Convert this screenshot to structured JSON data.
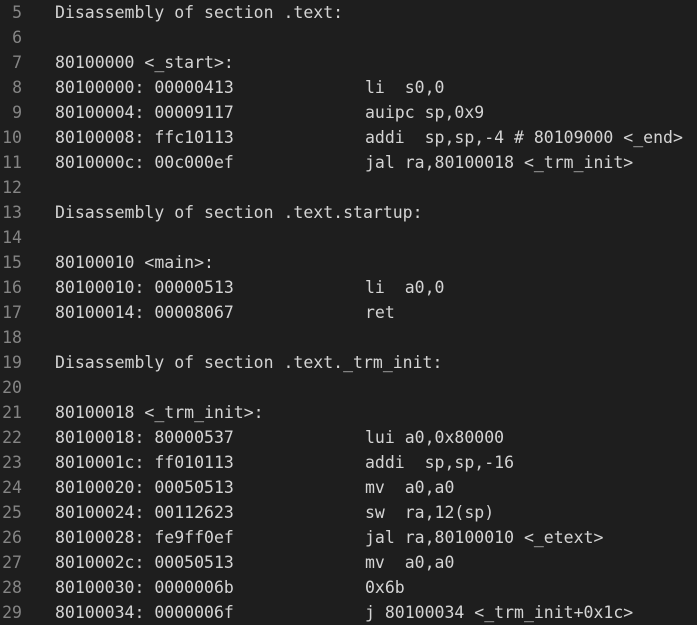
{
  "editor": {
    "lines": [
      {
        "num": "5",
        "text": "Disassembly of section .text:"
      },
      {
        "num": "6",
        "text": ""
      },
      {
        "num": "7",
        "text": "80100000 <_start>:"
      },
      {
        "num": "8",
        "addr": "80100000: 00000413",
        "instr": "li  s0,0"
      },
      {
        "num": "9",
        "addr": "80100004: 00009117",
        "instr": "auipc sp,0x9"
      },
      {
        "num": "10",
        "addr": "80100008: ffc10113",
        "instr": "addi  sp,sp,-4 # 80109000 <_end>"
      },
      {
        "num": "11",
        "addr": "8010000c: 00c000ef",
        "instr": "jal ra,80100018 <_trm_init>"
      },
      {
        "num": "12",
        "text": ""
      },
      {
        "num": "13",
        "text": "Disassembly of section .text.startup:"
      },
      {
        "num": "14",
        "text": ""
      },
      {
        "num": "15",
        "text": "80100010 <main>:"
      },
      {
        "num": "16",
        "addr": "80100010: 00000513",
        "instr": "li  a0,0"
      },
      {
        "num": "17",
        "addr": "80100014: 00008067",
        "instr": "ret"
      },
      {
        "num": "18",
        "text": ""
      },
      {
        "num": "19",
        "text": "Disassembly of section .text._trm_init:"
      },
      {
        "num": "20",
        "text": ""
      },
      {
        "num": "21",
        "text": "80100018 <_trm_init>:"
      },
      {
        "num": "22",
        "addr": "80100018: 80000537",
        "instr": "lui a0,0x80000"
      },
      {
        "num": "23",
        "addr": "8010001c: ff010113",
        "instr": "addi  sp,sp,-16"
      },
      {
        "num": "24",
        "addr": "80100020: 00050513",
        "instr": "mv  a0,a0"
      },
      {
        "num": "25",
        "addr": "80100024: 00112623",
        "instr": "sw  ra,12(sp)"
      },
      {
        "num": "26",
        "addr": "80100028: fe9ff0ef",
        "instr": "jal ra,80100010 <_etext>"
      },
      {
        "num": "27",
        "addr": "8010002c: 00050513",
        "instr": "mv  a0,a0"
      },
      {
        "num": "28",
        "addr": "80100030: 0000006b",
        "instr": "0x6b"
      },
      {
        "num": "29",
        "addr": "80100034: 0000006f",
        "instr": "j 80100034 <_trm_init+0x1c>"
      }
    ]
  }
}
